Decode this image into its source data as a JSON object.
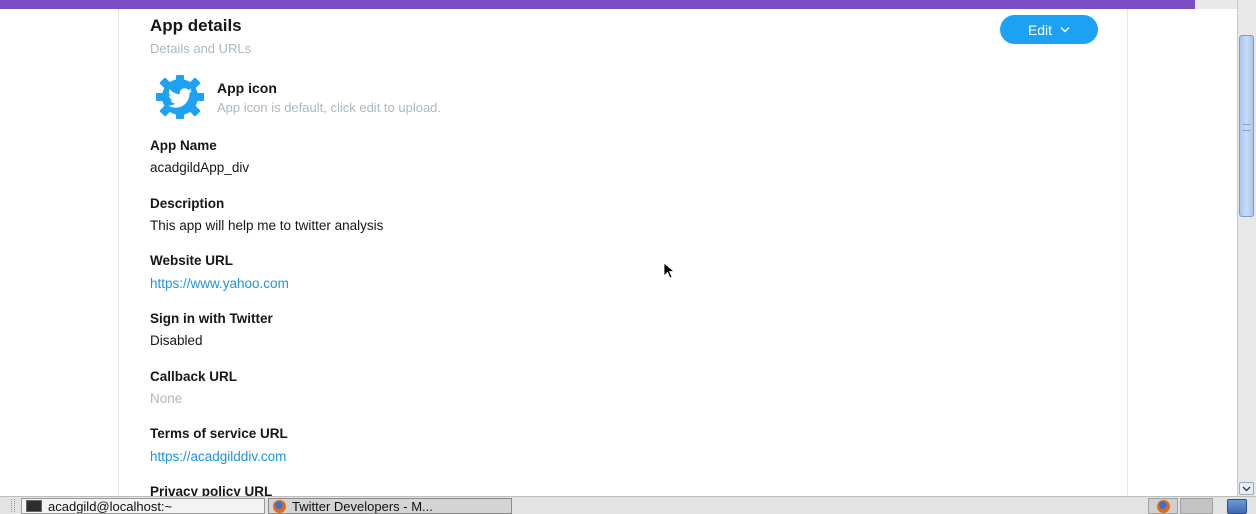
{
  "section": {
    "title": "App details",
    "subtitle": "Details and URLs",
    "edit_label": "Edit"
  },
  "app_icon": {
    "label": "App icon",
    "help": "App icon is default, click edit to upload."
  },
  "fields": {
    "app_name": {
      "label": "App Name",
      "value": "acadgildApp_div"
    },
    "description": {
      "label": "Description",
      "value": "This app will help me to twitter analysis"
    },
    "website_url": {
      "label": "Website URL",
      "value": "https://www.yahoo.com"
    },
    "sign_in": {
      "label": "Sign in with Twitter",
      "value": "Disabled"
    },
    "callback_url": {
      "label": "Callback URL",
      "value": "None"
    },
    "terms_url": {
      "label": "Terms of service URL",
      "value": "https://acadgilddiv.com"
    },
    "privacy_url": {
      "label": "Privacy policy URL"
    }
  },
  "taskbar": {
    "items": [
      {
        "label": "acadgild@localhost:~",
        "icon": "terminal-icon"
      },
      {
        "label": "Twitter Developers - M...",
        "icon": "firefox-icon"
      }
    ]
  },
  "colors": {
    "accent_bar": "#7b4fc4",
    "button": "#1da1f2",
    "link": "#1b95e0",
    "muted": "#aab8c2"
  }
}
